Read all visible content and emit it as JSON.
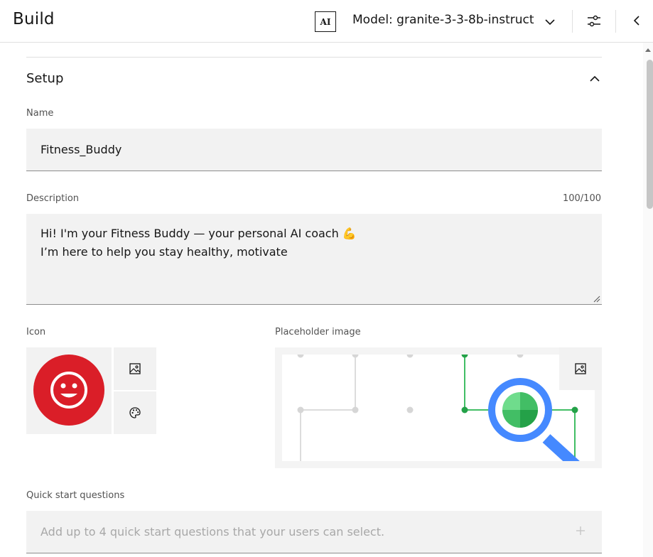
{
  "header": {
    "title": "Build",
    "ai_badge": "AI",
    "model_label": "Model: granite-3-3-8b-instruct"
  },
  "setup": {
    "section_title": "Setup",
    "name": {
      "label": "Name",
      "value": "Fitness_Buddy"
    },
    "description": {
      "label": "Description",
      "counter": "100/100",
      "value": "Hi! I'm your Fitness Buddy — your personal AI coach 💪\nI’m here to help you stay healthy, motivate"
    },
    "icon": {
      "label": "Icon",
      "color": "#da1e28"
    },
    "placeholder_image": {
      "label": "Placeholder image"
    },
    "quick_start": {
      "label": "Quick start questions",
      "placeholder": "Add up to 4 quick start questions that your users can select."
    }
  },
  "icons": [
    "chevron-down-icon",
    "settings-sliders-icon",
    "chevron-left-icon",
    "chevron-up-icon",
    "image-icon",
    "palette-icon",
    "add-icon",
    "smiley-icon"
  ]
}
